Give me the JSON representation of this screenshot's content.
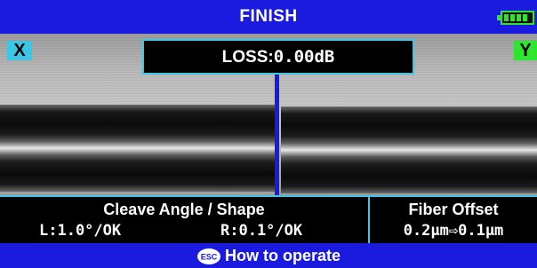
{
  "title_bar": {
    "title": "FINISH",
    "battery_icon": "battery-full-icon",
    "battery_color": "#2ee62e"
  },
  "fiber_view": {
    "left_label": "X",
    "right_label": "Y",
    "left_label_color": "#3cc6e6",
    "right_label_color": "#2ee62e"
  },
  "loss": {
    "label": "LOSS:",
    "value": "0.00dB"
  },
  "cleave": {
    "title": "Cleave Angle / Shape",
    "left": "L:1.0°/OK",
    "right": "R:0.1°/OK"
  },
  "offset": {
    "title": "Fiber Offset",
    "values": "0.2μm⇨0.1μm"
  },
  "help": {
    "icon": "esc-key-icon",
    "label": "How to operate"
  },
  "colors": {
    "accent": "#1b1be0",
    "frame": "#3cc6e6"
  }
}
